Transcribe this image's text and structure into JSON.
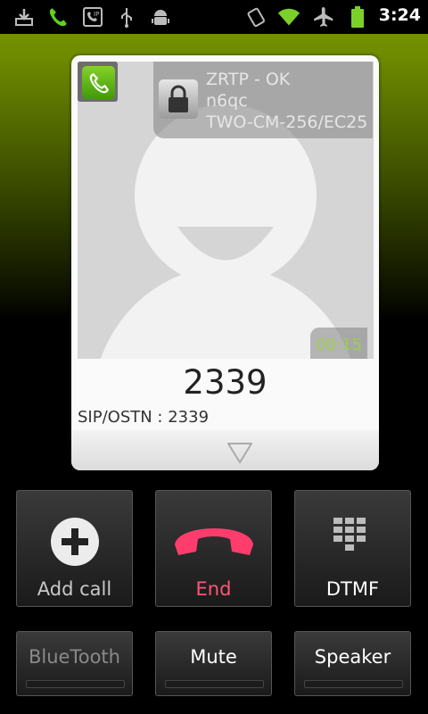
{
  "status_bar": {
    "time": "3:24",
    "icons_left": [
      "download-icon",
      "call-icon",
      "sip-icon",
      "usb-icon",
      "android-debug-icon"
    ],
    "icons_right": [
      "vibrate-icon",
      "wifi-icon",
      "airplane-icon",
      "battery-icon"
    ]
  },
  "call_card": {
    "zrtp_status": "ZRTP - OK",
    "sas": "n6qc",
    "cipher": "TWO-CM-256/EC25",
    "timer": "00:15",
    "number": "2339",
    "account": "SIP/OSTN : 2339"
  },
  "actions": {
    "add_call": "Add call",
    "end": "End",
    "dtmf": "DTMF",
    "bluetooth": "BlueTooth",
    "mute": "Mute",
    "speaker": "Speaker"
  },
  "colors": {
    "accent_green": "#86d12a",
    "end_red": "#ff3d6c",
    "timer_green": "#9bd14a"
  }
}
